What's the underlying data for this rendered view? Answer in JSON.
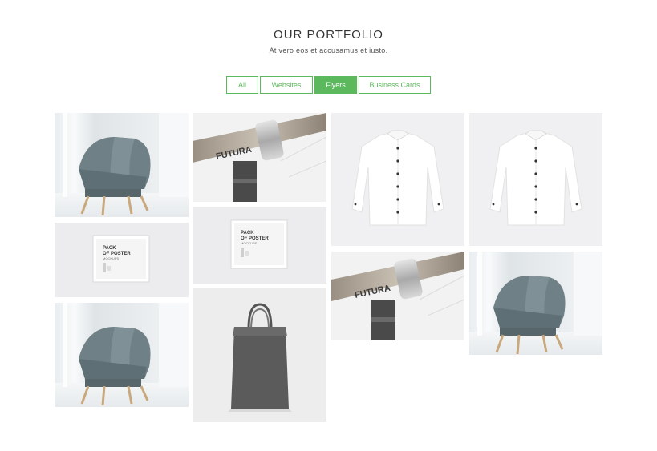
{
  "header": {
    "title": "OUR PORTFOLIO",
    "subtitle": "At vero eos et accusamus et iusto."
  },
  "filters": [
    {
      "label": "All",
      "active": false
    },
    {
      "label": "Websites",
      "active": false
    },
    {
      "label": "Flyers",
      "active": true
    },
    {
      "label": "Business Cards",
      "active": false
    }
  ],
  "portfolio": {
    "items": [
      {
        "name": "chair"
      },
      {
        "name": "poster-frame"
      },
      {
        "name": "chair"
      },
      {
        "name": "bike-handlebar"
      },
      {
        "name": "poster-frame"
      },
      {
        "name": "tote-bag"
      },
      {
        "name": "shirt"
      },
      {
        "name": "bike-handlebar"
      },
      {
        "name": "shirt"
      },
      {
        "name": "chair"
      }
    ],
    "poster_text": [
      "PACK",
      "OF POSTER",
      "MOCKUPS"
    ],
    "handlebar_text": "FUTURA"
  },
  "colors": {
    "accent": "#5cb85c"
  }
}
